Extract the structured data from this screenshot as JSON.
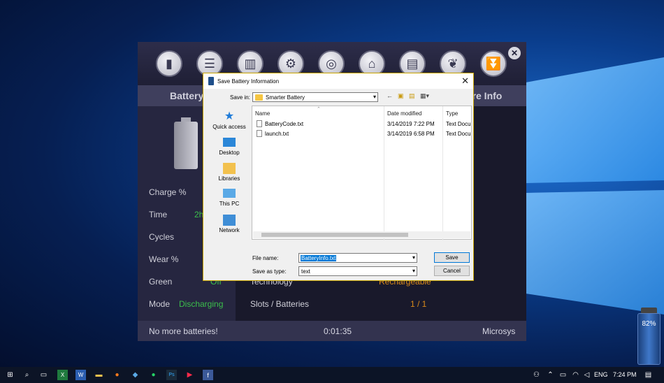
{
  "app": {
    "tab_left": "Battery",
    "tab_right": "ore Info",
    "close_glyph": "✕",
    "toolbar_icons": [
      "battery-icon",
      "list-icon",
      "chart-icon",
      "gear-icon",
      "target-icon",
      "home-icon",
      "book-icon",
      "leaf-icon",
      "download-icon"
    ],
    "stats": [
      {
        "label": "Charge %",
        "value": ""
      },
      {
        "label": "Time",
        "value": "2h"
      },
      {
        "label": "Cycles",
        "value": ""
      },
      {
        "label": "Wear %",
        "value": ""
      },
      {
        "label": "Green",
        "value": "Off"
      },
      {
        "label": "Mode",
        "value": "Discharging"
      }
    ],
    "right_rows": [
      {
        "label": "Technology",
        "value": "Rechargeable"
      },
      {
        "label": "Slots / Batteries",
        "value": "1 / 1"
      }
    ],
    "status": {
      "left": "No more batteries!",
      "center": "0:01:35",
      "right": "Microsys"
    }
  },
  "dialog": {
    "title": "Save Battery Information",
    "save_in_label": "Save in:",
    "save_in_value": "Smarter Battery",
    "places": [
      "Quick access",
      "Desktop",
      "Libraries",
      "This PC",
      "Network"
    ],
    "columns": [
      "Name",
      "Date modified",
      "Type"
    ],
    "files": [
      {
        "name": "BatteryCode.txt",
        "date": "3/14/2019 7:22 PM",
        "type": "Text Docu"
      },
      {
        "name": "launch.txt",
        "date": "3/14/2019 6:58 PM",
        "type": "Text Docu"
      }
    ],
    "file_name_label": "File name:",
    "file_name_value": "BatteryInfo.txt",
    "save_type_label": "Save as type:",
    "save_type_value": "text",
    "save_button": "Save",
    "cancel_button": "Cancel"
  },
  "gadget": {
    "percent": "82%"
  },
  "taskbar": {
    "language": "ENG",
    "time": "7:24 PM"
  }
}
